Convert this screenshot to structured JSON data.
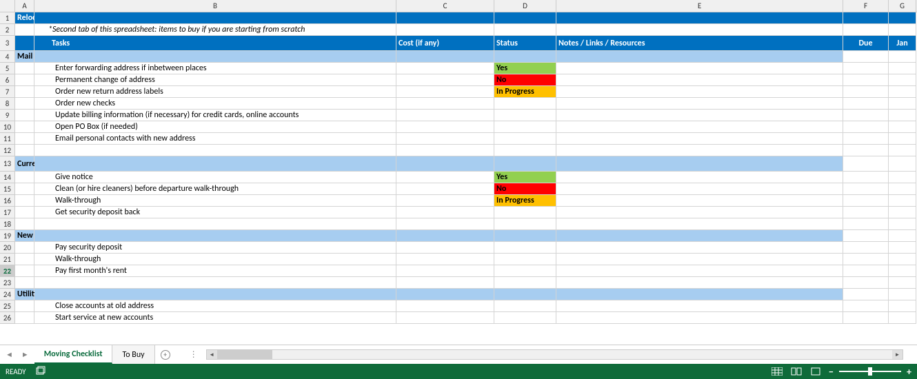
{
  "columns": [
    "A",
    "B",
    "C",
    "D",
    "E",
    "F",
    "G"
  ],
  "rows_visible": 26,
  "selected_row": 22,
  "title_row": {
    "text": "Relocation Checklist"
  },
  "subtitle_row": {
    "text": "*Second tab of this spreadsheet: items to buy if you are starting from scratch"
  },
  "header_row": {
    "B": "Tasks",
    "C": "Cost (if any)",
    "D": "Status",
    "E": "Notes / Links / Resources",
    "F": "Due",
    "G": "Jan"
  },
  "rows": [
    {
      "n": 1,
      "type": "title"
    },
    {
      "n": 2,
      "type": "subtitle"
    },
    {
      "n": 3,
      "type": "header",
      "tall": true
    },
    {
      "n": 4,
      "type": "section",
      "text": "Mail & Post Office"
    },
    {
      "n": 5,
      "type": "task",
      "text": "Enter forwarding address if inbetween places",
      "status": "Yes",
      "status_class": "bg-green"
    },
    {
      "n": 6,
      "type": "task",
      "text": "Permanent change of address",
      "status": "No",
      "status_class": "bg-red"
    },
    {
      "n": 7,
      "type": "task",
      "text": "Order new return address labels",
      "status": "In Progress",
      "status_class": "bg-orange"
    },
    {
      "n": 8,
      "type": "task",
      "text": "Order new checks"
    },
    {
      "n": 9,
      "type": "task",
      "text": "Update billing information (if necessary) for credit cards, online accounts"
    },
    {
      "n": 10,
      "type": "task",
      "text": "Open PO Box (if needed)"
    },
    {
      "n": 11,
      "type": "task",
      "text": "Email personal contacts with new address"
    },
    {
      "n": 12,
      "type": "blank"
    },
    {
      "n": 13,
      "type": "section",
      "text": "Current Landlord (if applicable)",
      "tall": true
    },
    {
      "n": 14,
      "type": "task",
      "text": "Give notice",
      "status": "Yes",
      "status_class": "bg-green"
    },
    {
      "n": 15,
      "type": "task",
      "text": "Clean (or hire cleaners) before departure walk-through",
      "status": "No",
      "status_class": "bg-red"
    },
    {
      "n": 16,
      "type": "task",
      "text": "Walk-through",
      "status": "In Progress",
      "status_class": "bg-orange"
    },
    {
      "n": 17,
      "type": "task",
      "text": "Get security deposit back"
    },
    {
      "n": 18,
      "type": "blank"
    },
    {
      "n": 19,
      "type": "section",
      "text": "New Landlord (if applicable)"
    },
    {
      "n": 20,
      "type": "task",
      "text": "Pay security deposit"
    },
    {
      "n": 21,
      "type": "task",
      "text": "Walk-through"
    },
    {
      "n": 22,
      "type": "task",
      "text": "Pay first month's rent"
    },
    {
      "n": 23,
      "type": "blank"
    },
    {
      "n": 24,
      "type": "section",
      "text": "Utilities/Insurance"
    },
    {
      "n": 25,
      "type": "task",
      "text": "Close accounts at old address"
    },
    {
      "n": 26,
      "type": "task",
      "text": "Start service at new accounts"
    }
  ],
  "tabs": [
    "Moving Checklist",
    "To Buy"
  ],
  "active_tab": 0,
  "status_bar": {
    "ready": "READY"
  }
}
